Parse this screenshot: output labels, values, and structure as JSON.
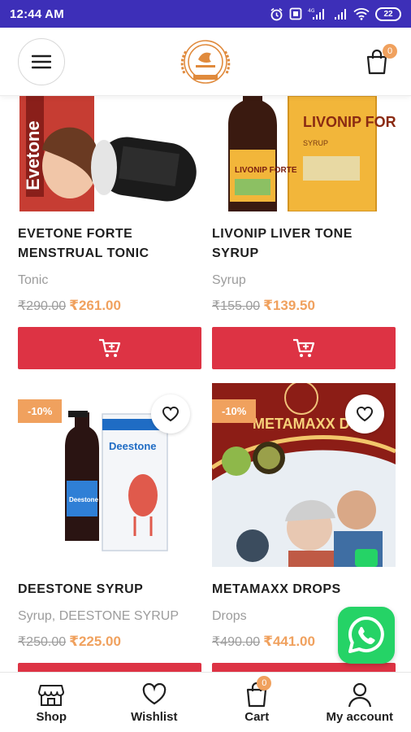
{
  "status_bar": {
    "time": "12:44 AM",
    "battery": "22",
    "network": "4G"
  },
  "header": {
    "cart_count": "0"
  },
  "products": [
    {
      "title": "EVETONE FORTE MENSTRUAL TONIC",
      "category": "Tonic",
      "old_price": "₹290.00",
      "price": "₹261.00",
      "sale": "",
      "package_text": "Evetone"
    },
    {
      "title": "LIVONIP LIVER TONE SYRUP",
      "category": "Syrup",
      "old_price": "₹155.00",
      "price": "₹139.50",
      "sale": "",
      "package_text": "LIVONIP FORTE",
      "package_sub": "SYRUP",
      "bottle_label": "LIVONIP FORTE"
    },
    {
      "title": "DEESTONE SYRUP",
      "category": "Syrup, DEESTONE SYRUP",
      "old_price": "₹250.00",
      "price": "₹225.00",
      "sale": "-10%",
      "package_text": "Deestone",
      "bottle_label": "Deestone"
    },
    {
      "title": "METAMAXX DROPS",
      "category": "Drops",
      "old_price": "₹490.00",
      "price": "₹441.00",
      "sale": "-10%",
      "banner_text": "METAMAXX DR"
    }
  ],
  "bottom_nav": {
    "items": [
      {
        "label": "Shop",
        "icon": "store-icon"
      },
      {
        "label": "Wishlist",
        "icon": "heart-icon"
      },
      {
        "label": "Cart",
        "icon": "bag-icon",
        "badge": "0"
      },
      {
        "label": "My account",
        "icon": "user-icon"
      }
    ]
  },
  "colors": {
    "status_bar": "#3d2fb8",
    "accent_red": "#dd3344",
    "price_orange": "#f0a15e",
    "whatsapp_green": "#25d366"
  }
}
